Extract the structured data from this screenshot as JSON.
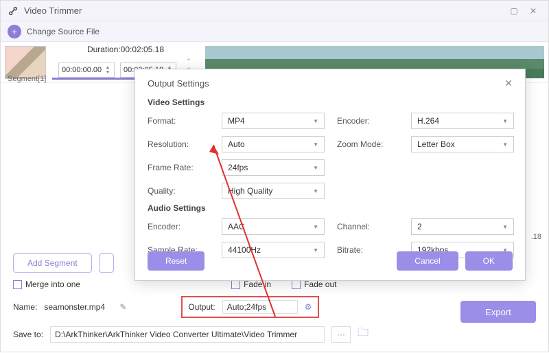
{
  "window": {
    "title": "Video Trimmer"
  },
  "toolbar": {
    "change_source": "Change Source File"
  },
  "editor": {
    "duration_label": "Duration:",
    "duration_value": "00:02:05.18",
    "start_time": "00:00:00.00",
    "end_time": "00:02:05.18",
    "segment_label": "Segment[1]",
    "right_timestamp": ".18"
  },
  "bottom": {
    "add_segment": "Add Segment",
    "merge": "Merge into one",
    "fade_in": "Fade in",
    "fade_out": "Fade out",
    "name_label": "Name:",
    "name_value": "seamonster.mp4",
    "output_label": "Output:",
    "output_value": "Auto;24fps",
    "export": "Export",
    "save_label": "Save to:",
    "save_path": "D:\\ArkThinker\\ArkThinker Video Converter Ultimate\\Video Trimmer"
  },
  "dialog": {
    "title": "Output Settings",
    "video_section": "Video Settings",
    "audio_section": "Audio Settings",
    "labels": {
      "format": "Format:",
      "encoder_v": "Encoder:",
      "resolution": "Resolution:",
      "zoom": "Zoom Mode:",
      "framerate": "Frame Rate:",
      "quality": "Quality:",
      "encoder_a": "Encoder:",
      "channel": "Channel:",
      "samplerate": "Sample Rate:",
      "bitrate": "Bitrate:"
    },
    "values": {
      "format": "MP4",
      "encoder_v": "H.264",
      "resolution": "Auto",
      "zoom": "Letter Box",
      "framerate": "24fps",
      "quality": "High Quality",
      "encoder_a": "AAC",
      "channel": "2",
      "samplerate": "44100Hz",
      "bitrate": "192kbps"
    },
    "reset": "Reset",
    "cancel": "Cancel",
    "ok": "OK"
  }
}
